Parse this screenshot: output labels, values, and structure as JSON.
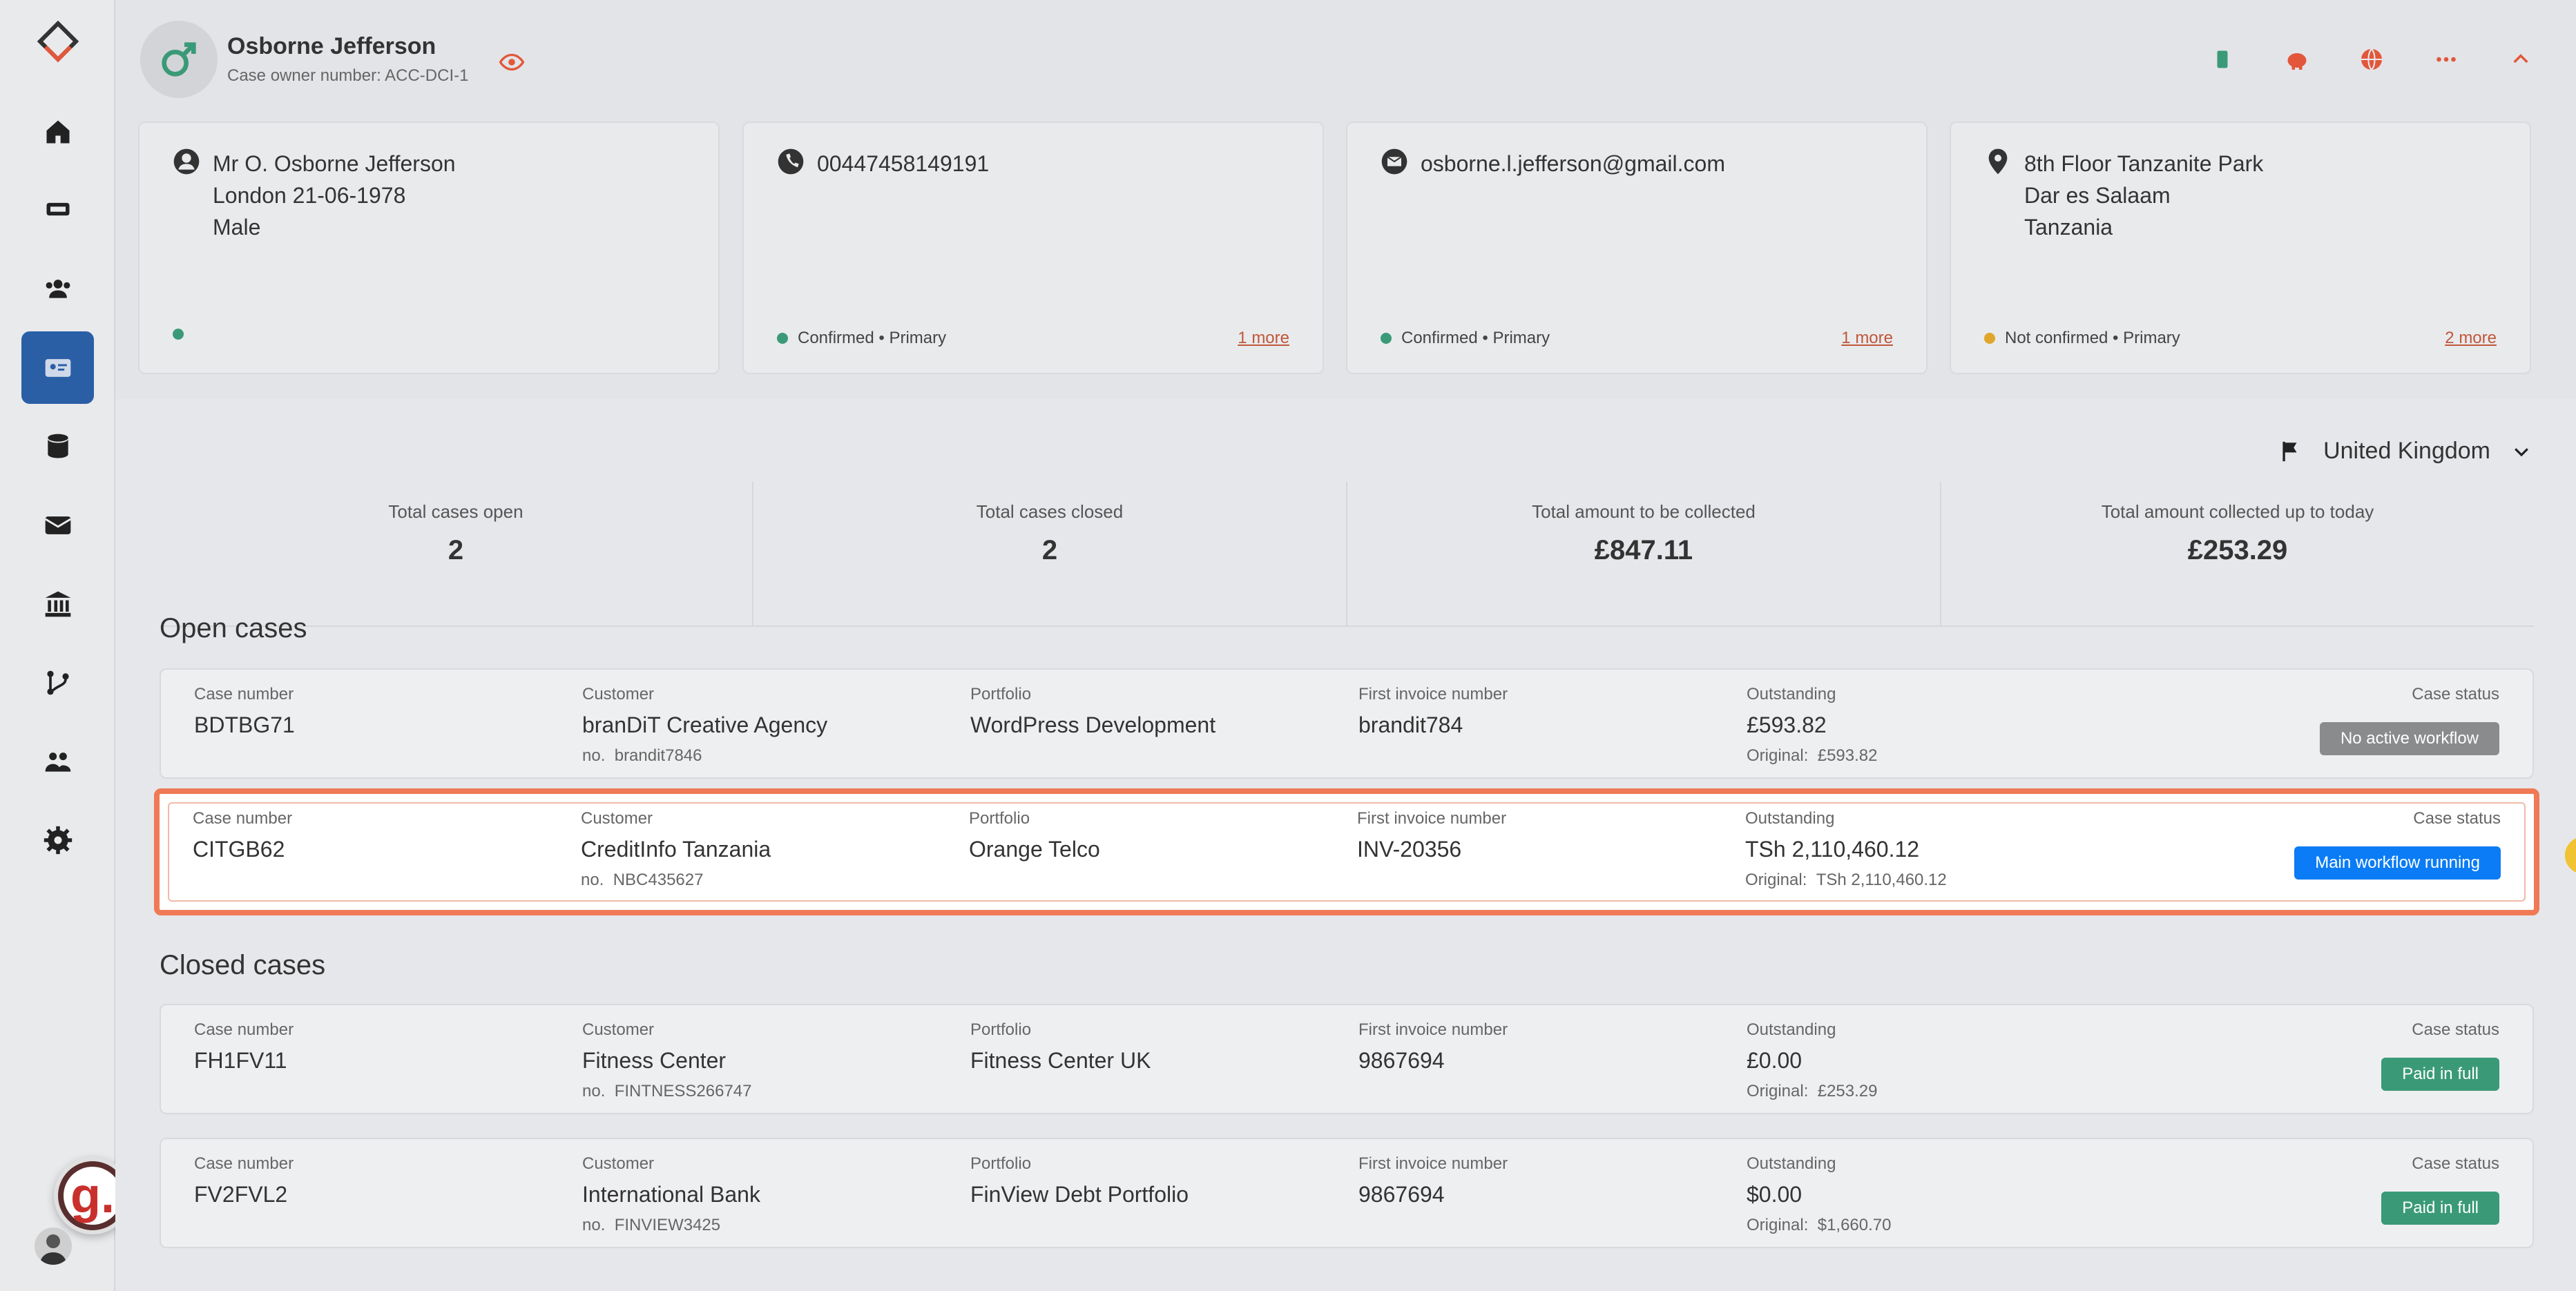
{
  "header": {
    "name": "Osborne Jefferson",
    "owner_number": "Case owner number: ACC-DCI-1"
  },
  "cards": {
    "person": {
      "lines": [
        "Mr O. Osborne Jefferson",
        "London 21-06-1978",
        "Male"
      ]
    },
    "phone": {
      "value": "00447458149191",
      "status": "Confirmed • Primary",
      "more": "1 more"
    },
    "email": {
      "value": "osborne.l.jefferson@gmail.com",
      "status": "Confirmed • Primary",
      "more": "1 more"
    },
    "address": {
      "lines": [
        "8th Floor Tanzanite Park",
        "Dar es Salaam",
        "Tanzania"
      ],
      "status": "Not confirmed • Primary",
      "more": "2 more"
    }
  },
  "country": "United Kingdom",
  "stats": [
    {
      "label": "Total cases open",
      "value": "2"
    },
    {
      "label": "Total cases closed",
      "value": "2"
    },
    {
      "label": "Total amount to be collected",
      "value": "£847.11"
    },
    {
      "label": "Total amount collected up to today",
      "value": "£253.29"
    }
  ],
  "labels": {
    "case_number": "Case number",
    "customer": "Customer",
    "portfolio": "Portfolio",
    "first_invoice": "First invoice number",
    "outstanding": "Outstanding",
    "case_status": "Case status",
    "no_prefix": "no.",
    "original_prefix": "Original:"
  },
  "open_cases_title": "Open cases",
  "closed_cases_title": "Closed cases",
  "open_cases": [
    {
      "case": "BDTBG71",
      "customer": "branDiT Creative Agency",
      "customer_no": "brandit7846",
      "portfolio": "WordPress Development",
      "invoice": "brandit784",
      "outstanding": "£593.82",
      "original": "£593.82",
      "status": "No active workflow"
    },
    {
      "case": "CITGB62",
      "customer": "CreditInfo Tanzania",
      "customer_no": "NBC435627",
      "portfolio": "Orange Telco",
      "invoice": "INV-20356",
      "outstanding": "TSh 2,110,460.12",
      "original": "TSh 2,110,460.12",
      "status": "Main workflow running"
    }
  ],
  "closed_cases": [
    {
      "case": "FH1FV11",
      "customer": "Fitness Center",
      "customer_no": "FINTNESS266747",
      "portfolio": "Fitness Center UK",
      "invoice": "9867694",
      "outstanding": "£0.00",
      "original": "£253.29",
      "status": "Paid in full"
    },
    {
      "case": "FV2FVL2",
      "customer": "International Bank",
      "customer_no": "FINVIEW3425",
      "portfolio": "FinView Debt Portfolio",
      "invoice": "9867694",
      "outstanding": "$0.00",
      "original": "$1,660.70",
      "status": "Paid in full"
    }
  ],
  "badge_letter": "g.",
  "colors": {
    "accent": "#ef7a55",
    "nav_active": "#2a5fa5",
    "status_blue": "#0b7cf5",
    "status_green": "#3a9a78",
    "status_grey": "#8a8b8d"
  }
}
